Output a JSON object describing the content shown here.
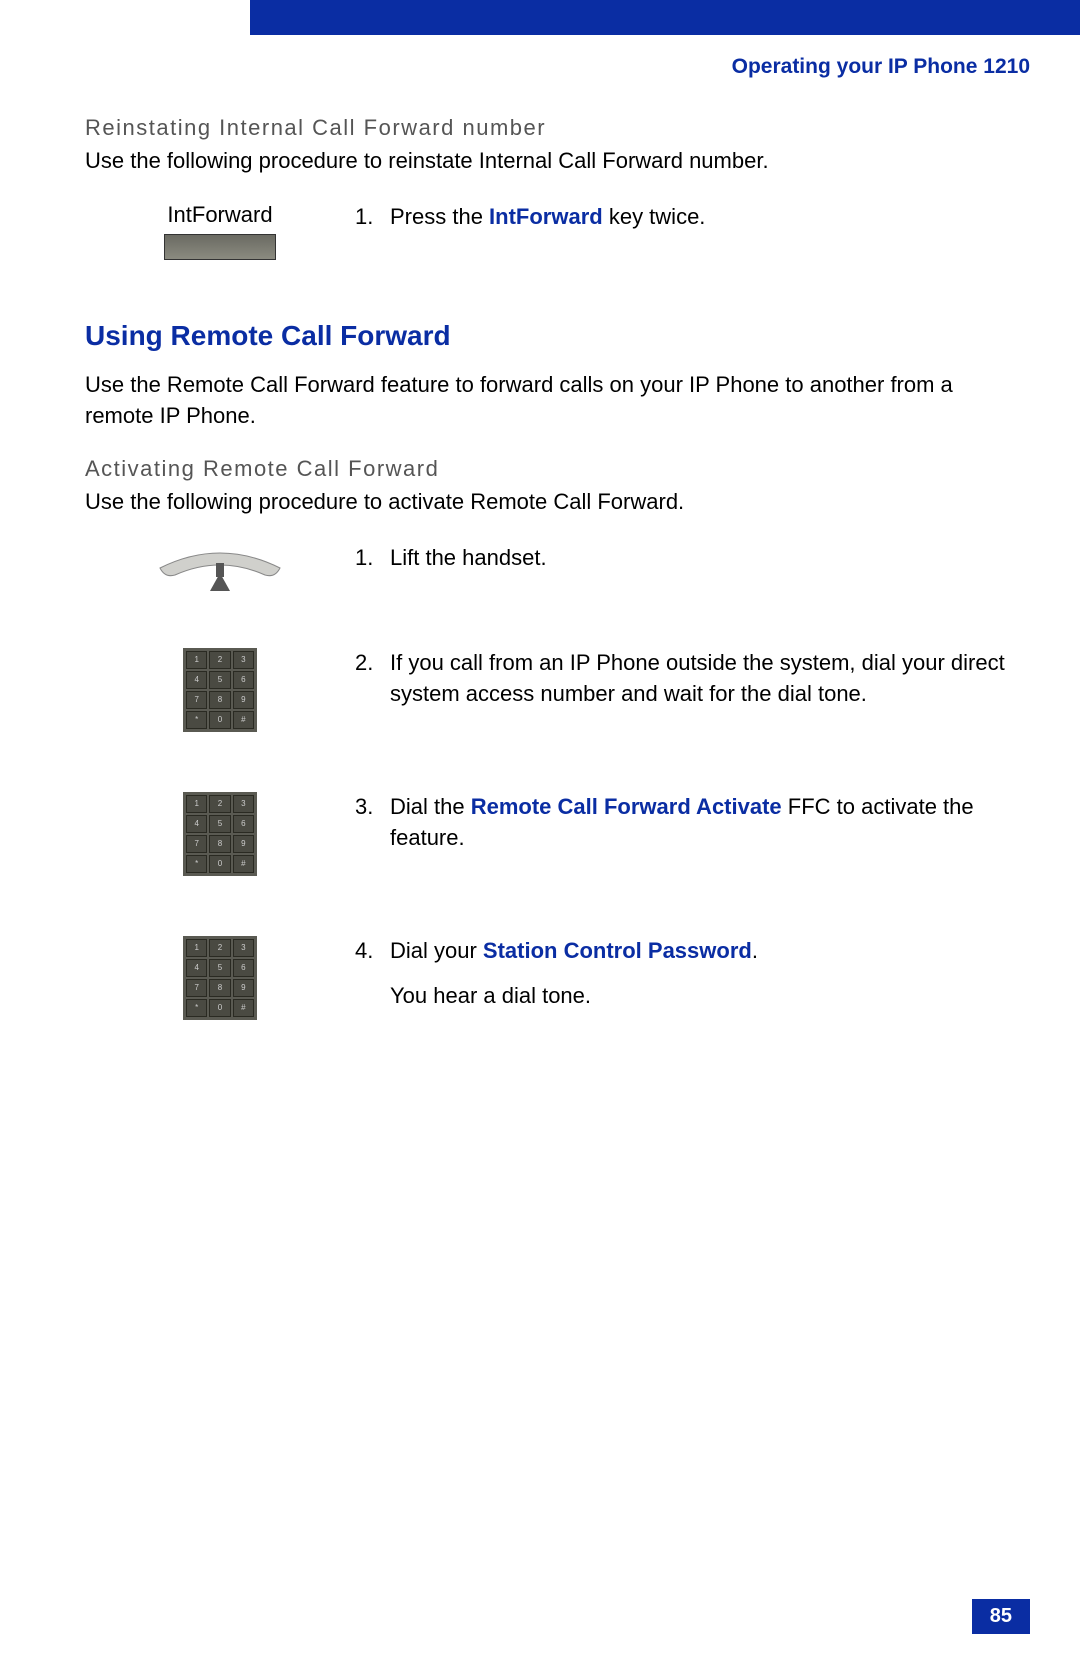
{
  "header": {
    "doc_title": "Operating your IP Phone 1210"
  },
  "section_reinstate": {
    "heading": "Reinstating Internal Call Forward number",
    "intro": "Use the following procedure to reinstate Internal Call Forward number.",
    "softkey_label": "IntForward",
    "step1_num": "1.",
    "step1_pre": "Press the ",
    "step1_bold": "IntForward",
    "step1_post": " key twice."
  },
  "section_remote": {
    "title": "Using Remote Call Forward",
    "intro": "Use the Remote Call Forward feature to forward calls on your IP Phone to another from a remote IP Phone.",
    "sub": "Activating Remote Call Forward",
    "sub_intro": "Use the following procedure to activate Remote Call Forward.",
    "steps": [
      {
        "num": "1.",
        "lines": [
          {
            "pre": "Lift the handset."
          }
        ]
      },
      {
        "num": "2.",
        "lines": [
          {
            "pre": "If you call from an IP Phone outside the system, dial your direct system access number and wait for the dial tone."
          }
        ]
      },
      {
        "num": "3.",
        "lines": [
          {
            "pre": "Dial the ",
            "bold": "Remote Call Forward Activate",
            "post": " FFC to activate the feature."
          }
        ]
      },
      {
        "num": "4.",
        "lines": [
          {
            "pre": "Dial your ",
            "bold": "Station Control Password",
            "post": "."
          },
          {
            "pre": "You hear a dial tone."
          }
        ]
      }
    ]
  },
  "page_number": "85"
}
